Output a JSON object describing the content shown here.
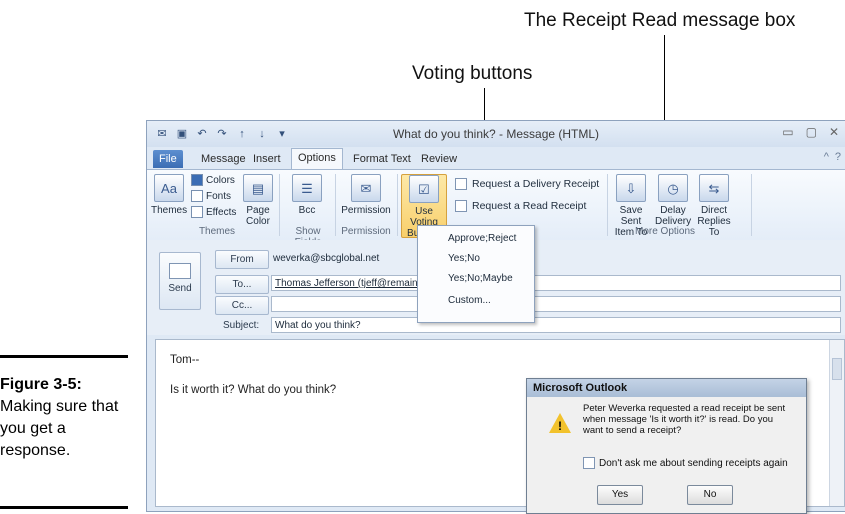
{
  "annotations": {
    "receipt_callout": "The Receipt Read message box",
    "voting_callout": "Voting buttons"
  },
  "caption": {
    "number": "Figure 3-5:",
    "text": "Making sure that you get a response."
  },
  "window": {
    "title": "What do you think? - Message (HTML)"
  },
  "tabs": [
    "File",
    "Message",
    "Insert",
    "Options",
    "Format Text",
    "Review"
  ],
  "ribbon": {
    "themes_label": "Themes",
    "colors_label": "Colors",
    "fonts_label": "Fonts",
    "effects_label": "Effects",
    "page_color_label": "Page Color",
    "bcc_label": "Bcc",
    "permission_label": "Permission",
    "use_voting_label": "Use Voting Buttons",
    "delivery_receipt_label": "Request a Delivery Receipt",
    "read_receipt_label": "Request a Read Receipt",
    "save_sent_label": "Save Sent Item To",
    "delay_delivery_label": "Delay Delivery",
    "direct_replies_label": "Direct Replies To",
    "groups": {
      "themes": "Themes",
      "show_fields": "Show Fields",
      "permission": "Permission",
      "more_options": "More Options"
    }
  },
  "voting_menu": {
    "items": [
      "Approve;Reject",
      "Yes;No",
      "Yes;No;Maybe",
      "Custom..."
    ]
  },
  "header": {
    "send_label": "Send",
    "from_label": "From",
    "from_value": "weverka@sbcglobal.net",
    "to_label": "To...",
    "to_value": "Thomas Jefferson (tjeff@remain.c",
    "cc_label": "Cc...",
    "subject_label": "Subject:",
    "subject_value": "What do you think?"
  },
  "body": {
    "line1": "Tom--",
    "line2": "Is it worth it? What do you think?"
  },
  "dialog": {
    "title": "Microsoft Outlook",
    "message": "Peter Weverka requested a read receipt be sent when message 'Is it worth it?' is read. Do you want to send a receipt?",
    "checkbox_label": "Don't ask me about sending receipts again",
    "yes_label": "Yes",
    "no_label": "No"
  }
}
